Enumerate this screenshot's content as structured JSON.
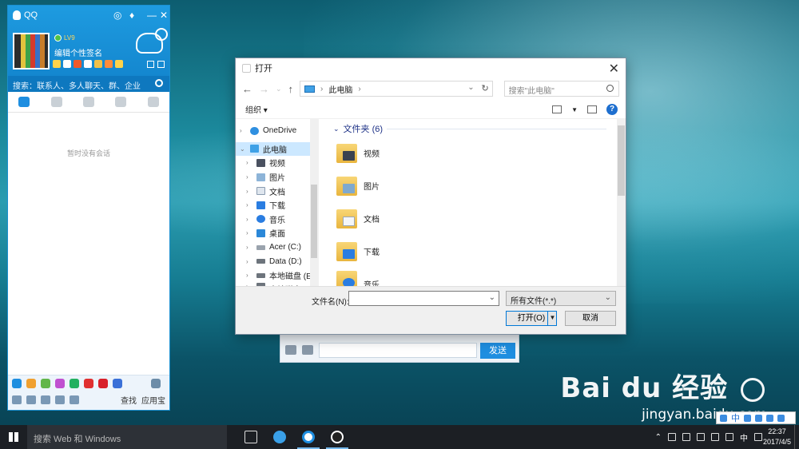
{
  "qq": {
    "app_title": "QQ",
    "level_badge": "LV9",
    "signature": "编辑个性签名",
    "search_placeholder": "搜索：联系人、多人聊天、群、企业",
    "empty_message": "暂时没有会话",
    "bottom_search": "查找",
    "bottom_app_store": "应用宝"
  },
  "chat": {
    "send_button": "发送"
  },
  "dialog": {
    "title": "打开",
    "breadcrumb": "此电脑",
    "search_placeholder": "搜索\"此电脑\"",
    "organize": "组织 ▾",
    "nav_items": [
      {
        "label": "OneDrive",
        "icon": "cloud-icon"
      },
      {
        "label": "此电脑",
        "icon": "computer-icon"
      },
      {
        "label": "视频",
        "icon": "video-folder-icon"
      },
      {
        "label": "图片",
        "icon": "pictures-folder-icon"
      },
      {
        "label": "文档",
        "icon": "documents-folder-icon"
      },
      {
        "label": "下载",
        "icon": "download-icon"
      },
      {
        "label": "音乐",
        "icon": "music-icon"
      },
      {
        "label": "桌面",
        "icon": "desktop-icon"
      },
      {
        "label": "Acer (C:)",
        "icon": "drive-icon"
      },
      {
        "label": "Data (D:)",
        "icon": "drive-icon"
      },
      {
        "label": "本地磁盘 (E:)",
        "icon": "drive-icon"
      },
      {
        "label": "本地磁盘 (F:)",
        "icon": "drive-icon"
      }
    ],
    "group_title": "文件夹 (6)",
    "folders": [
      {
        "label": "视频",
        "icon": "video-folder-icon"
      },
      {
        "label": "图片",
        "icon": "pictures-folder-icon"
      },
      {
        "label": "文档",
        "icon": "documents-folder-icon"
      },
      {
        "label": "下载",
        "icon": "download-folder-icon"
      },
      {
        "label": "音乐",
        "icon": "music-folder-icon"
      }
    ],
    "filename_label": "文件名(N):",
    "filename_value": "",
    "filetype_selected": "所有文件(*.*)",
    "open_button": "打开(O)",
    "cancel_button": "取消"
  },
  "watermark": {
    "brand": "Bai du 经验",
    "url": "jingyan.baidu.com"
  },
  "ime": {
    "mode": "中"
  },
  "taskbar": {
    "search_placeholder": "搜索 Web 和 Windows",
    "ime_indicator": "中",
    "time": "22:37",
    "date": "2017/4/5"
  },
  "colors": {
    "qq_blue": "#1487cf",
    "folder_title_blue": "#1e3287",
    "selection": "#cce8ff",
    "accent": "#0078d7"
  }
}
